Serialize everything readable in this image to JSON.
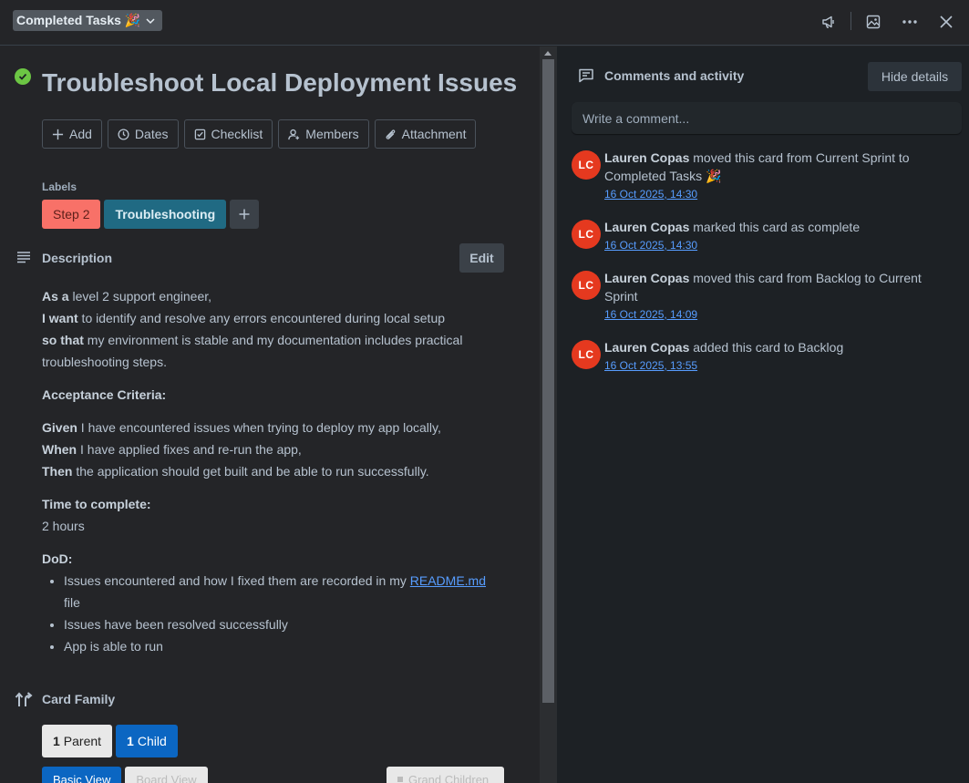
{
  "header": {
    "list_name": "Completed Tasks 🎉",
    "icons": [
      "megaphone-icon",
      "image-icon",
      "more-icon",
      "close-icon"
    ]
  },
  "card": {
    "title": "Troubleshoot Local Deployment Issues",
    "complete": true,
    "actions": [
      "Add",
      "Dates",
      "Checklist",
      "Members",
      "Attachment"
    ],
    "labels_heading": "Labels",
    "labels": [
      {
        "text": "Step 2",
        "color": "#f87168"
      },
      {
        "text": "Troubleshooting",
        "color": "#206a83"
      }
    ],
    "description_heading": "Description",
    "edit_label": "Edit",
    "description": {
      "story": [
        {
          "bold": "As a",
          "text": " level 2 support engineer,"
        },
        {
          "bold": "I want",
          "text": " to identify and resolve any errors encountered during local setup"
        },
        {
          "bold": "so that",
          "text": " my environment is stable and my documentation includes practical troubleshooting steps."
        }
      ],
      "acceptance_heading": "Acceptance Criteria:",
      "criteria": [
        {
          "bold": "Given",
          "text": " I have encountered issues when trying to deploy my app locally,"
        },
        {
          "bold": "When",
          "text": " I have applied fixes and re-run the app,"
        },
        {
          "bold": "Then",
          "text": " the application should get built and be able to run successfully."
        }
      ],
      "time_heading": "Time to complete:",
      "time_value": "2 hours",
      "dod_heading": "DoD:",
      "dod_items": [
        {
          "before": "Issues encountered and how I fixed them are recorded in my ",
          "link": "README.md",
          "after": " file"
        },
        {
          "before": "Issues have been resolved successfully",
          "link": "",
          "after": ""
        },
        {
          "before": "App is able to run",
          "link": "",
          "after": ""
        }
      ]
    },
    "family_heading": "Card Family",
    "parent_count": "1",
    "parent_label": "Parent",
    "child_count": "1",
    "child_label": "Child",
    "basic_view": "Basic View",
    "board_view": "Board View",
    "grand_children": "Grand Children"
  },
  "activity": {
    "heading": "Comments and activity",
    "hide_details": "Hide details",
    "comment_placeholder": "Write a comment...",
    "avatar_color": "#e5391f",
    "entries": [
      {
        "initials": "LC",
        "user": "Lauren Copas",
        "action": " moved this card from Current Sprint to Completed Tasks 🎉",
        "time": "16 Oct 2025, 14:30"
      },
      {
        "initials": "LC",
        "user": "Lauren Copas",
        "action": " marked this card as complete",
        "time": "16 Oct 2025, 14:30"
      },
      {
        "initials": "LC",
        "user": "Lauren Copas",
        "action": " moved this card from Backlog to Current Sprint",
        "time": "16 Oct 2025, 14:09"
      },
      {
        "initials": "LC",
        "user": "Lauren Copas",
        "action": " added this card to Backlog",
        "time": "16 Oct 2025, 13:55"
      }
    ]
  }
}
